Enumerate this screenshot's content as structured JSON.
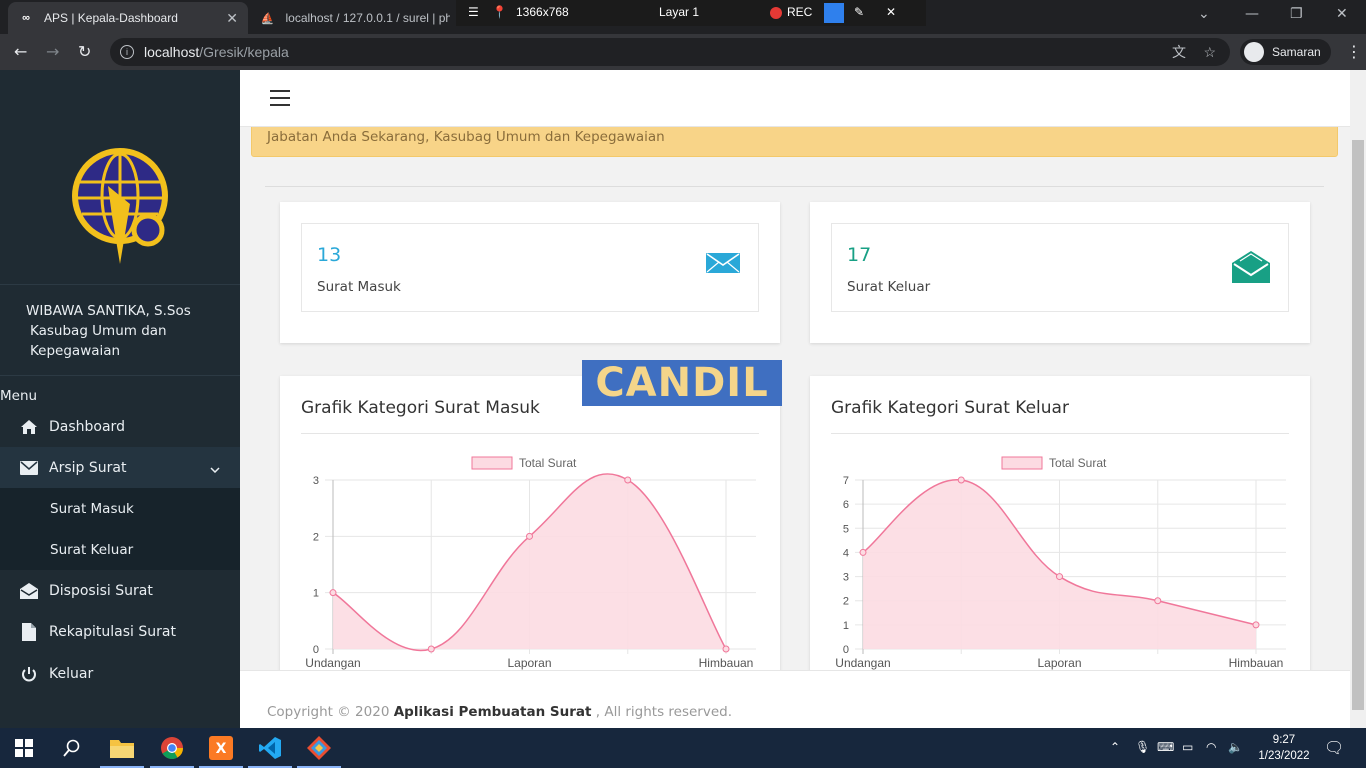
{
  "browser": {
    "tabs": [
      {
        "title": "APS | Kepala-Dashboard",
        "active": true
      },
      {
        "title": "localhost / 127.0.0.1 / surel | php",
        "active": false
      }
    ],
    "address": {
      "host": "localhost",
      "path": "/Gresik/kepala"
    },
    "profile_label": "Samaran"
  },
  "recorder": {
    "resolution": "1366x768",
    "layer": "Layar 1",
    "rec_label": "REC"
  },
  "sidebar": {
    "user_name": "WIBAWA SANTIKA, S.Sos",
    "user_role": "Kasubag Umum dan Kepegawaian",
    "menu_heading": "Menu",
    "items": [
      {
        "label": "Dashboard",
        "icon": "home-icon"
      },
      {
        "label": "Arsip Surat",
        "icon": "envelope-icon"
      },
      {
        "label": "Surat Masuk"
      },
      {
        "label": "Surat Keluar"
      },
      {
        "label": "Disposisi Surat",
        "icon": "envelope-open-icon"
      },
      {
        "label": "Rekapitulasi Surat",
        "icon": "file-icon"
      },
      {
        "label": "Keluar",
        "icon": "power-icon"
      }
    ]
  },
  "alert": {
    "text": "Jabatan Anda Sekarang, Kasubag Umum dan Kepegawaian"
  },
  "stats": [
    {
      "value": "13",
      "label": "Surat Masuk",
      "color": "#2aa8d8",
      "icon": "envelope-icon"
    },
    {
      "value": "17",
      "label": "Surat Keluar",
      "color": "#18a085",
      "icon": "envelope-open-icon"
    }
  ],
  "watermark": "CANDIL",
  "chart_data": [
    {
      "type": "area",
      "title": "Grafik Kategori Surat Masuk",
      "legend": "Total Surat",
      "legend_position": "top",
      "x_tick_labels": [
        "Undangan",
        "Laporan",
        "Himbauan"
      ],
      "values": [
        1,
        0,
        2,
        3,
        0
      ],
      "ylim": [
        0,
        3
      ],
      "yticks": [
        0,
        1,
        2,
        3
      ],
      "grid": true,
      "fill": "#fcdbe2",
      "line": "#f0779a"
    },
    {
      "type": "area",
      "title": "Grafik Kategori Surat Keluar",
      "legend": "Total Surat",
      "legend_position": "top",
      "x_tick_labels": [
        "Undangan",
        "Laporan",
        "Himbauan"
      ],
      "values": [
        4,
        7,
        3,
        2,
        1
      ],
      "ylim": [
        0,
        7
      ],
      "yticks": [
        0,
        1,
        2,
        3,
        4,
        5,
        6,
        7
      ],
      "grid": true,
      "fill": "#fcdbe2",
      "line": "#f0779a"
    }
  ],
  "footer": {
    "prefix": "Copyright © 2020",
    "app_name": "Aplikasi Pembuatan Surat",
    "suffix": ", All rights reserved."
  },
  "taskbar": {
    "time": "9:27",
    "date": "1/23/2022"
  }
}
